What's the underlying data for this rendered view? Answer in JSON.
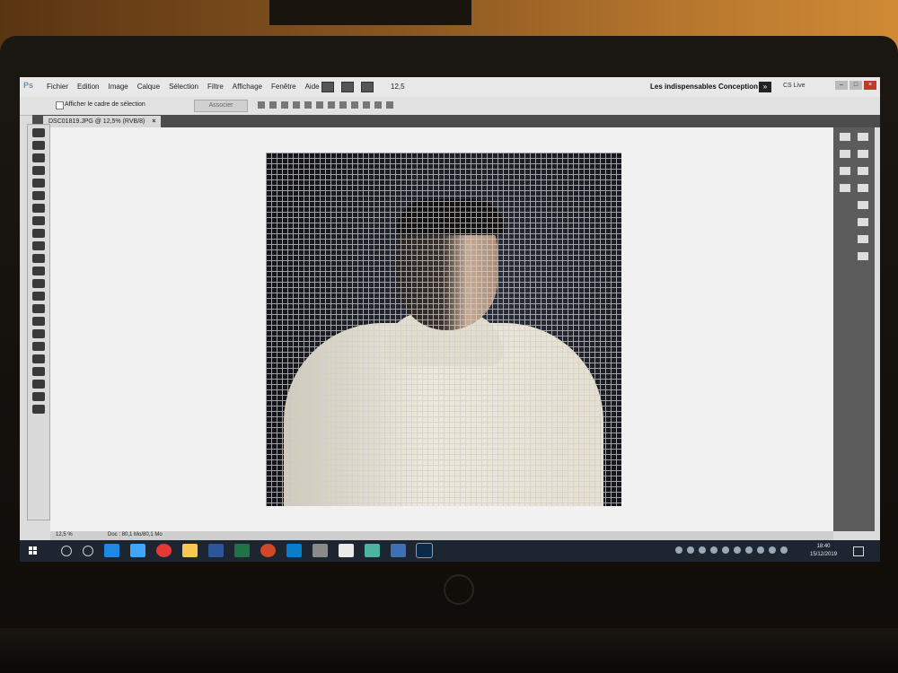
{
  "app": {
    "logo": "Ps",
    "menu": [
      "Fichier",
      "Edition",
      "Image",
      "Calque",
      "Sélection",
      "Filtre",
      "Affichage",
      "Fenêtre",
      "Aide"
    ],
    "zoom_select": "12,5",
    "workspaces": [
      "Les indispensables",
      "Conception"
    ],
    "cs_live": "CS Live"
  },
  "options_bar": {
    "show_bounding_box_label": "Afficher le cadre de sélection",
    "combine_button": "Associer"
  },
  "document": {
    "tab_title": "DSC01819.JPG @ 12,5% (RVB/8)",
    "close_glyph": "×"
  },
  "status_bar": {
    "zoom": "12,5 %",
    "doc_size": "Doc : 80,1 Mo/80,1 Mo"
  },
  "taskbar": {
    "time": "18:40",
    "date": "15/12/2019",
    "pinned_icons": [
      "search-icon",
      "task-view-icon",
      "edge-icon",
      "ie-icon",
      "chrome-icon",
      "file-explorer-icon",
      "word-icon",
      "excel-icon",
      "powerpoint-icon",
      "outlook-icon",
      "calculator-icon",
      "solitaire-icon",
      "app-icon",
      "store-icon",
      "photoshop-icon"
    ]
  },
  "colors": {
    "menubar": "#e8e8e8",
    "taskbar": "#1d2530",
    "dock": "#5c5c5c"
  }
}
